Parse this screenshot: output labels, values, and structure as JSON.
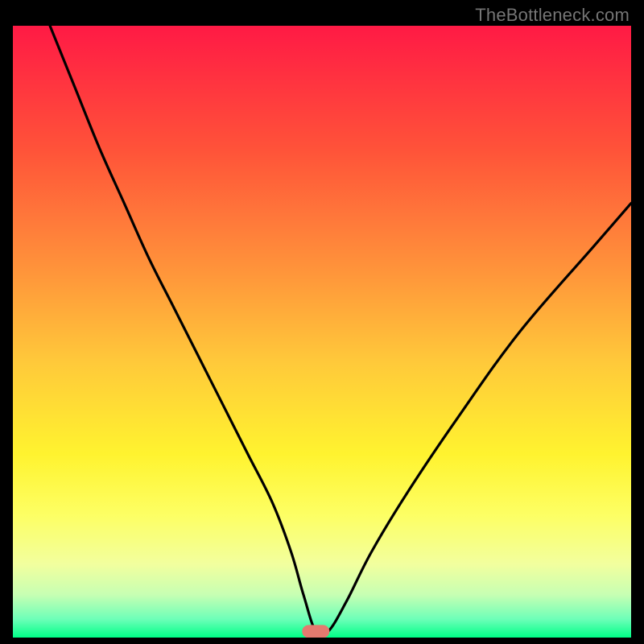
{
  "watermark": "TheBottleneck.com",
  "chart_data": {
    "type": "line",
    "title": "",
    "xlabel": "",
    "ylabel": "",
    "xlim": [
      0,
      100
    ],
    "ylim": [
      0,
      100
    ],
    "grid": false,
    "legend": false,
    "annotations": [
      {
        "name": "optimal-marker",
        "x": 49,
        "y": 1,
        "color": "#e47a6f"
      }
    ],
    "background_gradient": {
      "stops": [
        {
          "offset": 0.0,
          "color": "#ff1a45"
        },
        {
          "offset": 0.2,
          "color": "#ff5239"
        },
        {
          "offset": 0.4,
          "color": "#ff943a"
        },
        {
          "offset": 0.55,
          "color": "#ffc93a"
        },
        {
          "offset": 0.7,
          "color": "#fff32f"
        },
        {
          "offset": 0.8,
          "color": "#fdff64"
        },
        {
          "offset": 0.88,
          "color": "#f2ff9e"
        },
        {
          "offset": 0.93,
          "color": "#c7ffb3"
        },
        {
          "offset": 0.97,
          "color": "#6dffb8"
        },
        {
          "offset": 1.0,
          "color": "#00ff87"
        }
      ]
    },
    "series": [
      {
        "name": "bottleneck-curve",
        "color": "#000000",
        "x": [
          6,
          10,
          14,
          18,
          22,
          26,
          30,
          34,
          38,
          42,
          45,
          47,
          49,
          51,
          54,
          58,
          64,
          72,
          82,
          94,
          100
        ],
        "y": [
          100,
          90,
          80,
          71,
          62,
          54,
          46,
          38,
          30,
          22,
          14,
          7,
          1,
          1,
          6,
          14,
          24,
          36,
          50,
          64,
          71
        ]
      }
    ]
  }
}
